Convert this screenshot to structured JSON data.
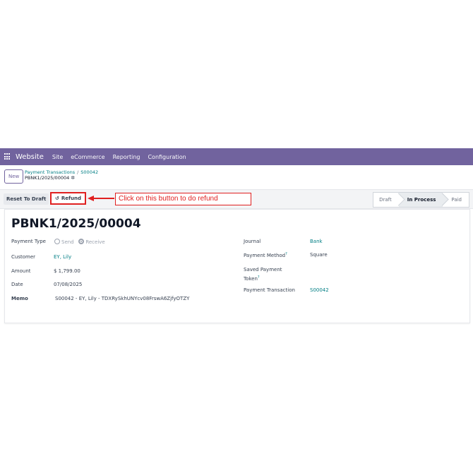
{
  "navbar": {
    "brand": "Website",
    "items": [
      "Site",
      "eCommerce",
      "Reporting",
      "Configuration"
    ]
  },
  "control": {
    "new_label": "New",
    "breadcrumb": {
      "parent": "Payment Transactions",
      "sep": "/",
      "child": "S00042",
      "current": "PBNK1/2025/00004"
    }
  },
  "statusbar": {
    "reset_label": "Reset To Draft",
    "refund_icon": "↺",
    "refund_label": "Refund",
    "annotation": "Click on this button to do refund",
    "stages": [
      "Draft",
      "In Process",
      "Paid"
    ],
    "active_stage": "In Process"
  },
  "form": {
    "title": "PBNK1/2025/00004",
    "left": {
      "payment_type_label": "Payment Type",
      "payment_type_options": [
        "Send",
        "Receive"
      ],
      "payment_type_selected": "Receive",
      "customer_label": "Customer",
      "customer_value": "EY, Lily",
      "amount_label": "Amount",
      "amount_value": "$ 1,799.00",
      "date_label": "Date",
      "date_value": "07/08/2025",
      "memo_label": "Memo",
      "memo_value": "S00042 - EY, Lily - TDXRySkhUNYcv08FrswA6ZjfyOTZY"
    },
    "right": {
      "journal_label": "Journal",
      "journal_value": "Bank",
      "payment_method_label": "Payment Method",
      "payment_method_value": "Square",
      "saved_token_label_1": "Saved Payment",
      "saved_token_label_2": "Token",
      "payment_transaction_label": "Payment Transaction",
      "payment_transaction_value": "S00042",
      "tip_mark": "?"
    }
  },
  "colors": {
    "navbar": "#71639e",
    "link": "#017e84",
    "annotation": "#e02020"
  }
}
